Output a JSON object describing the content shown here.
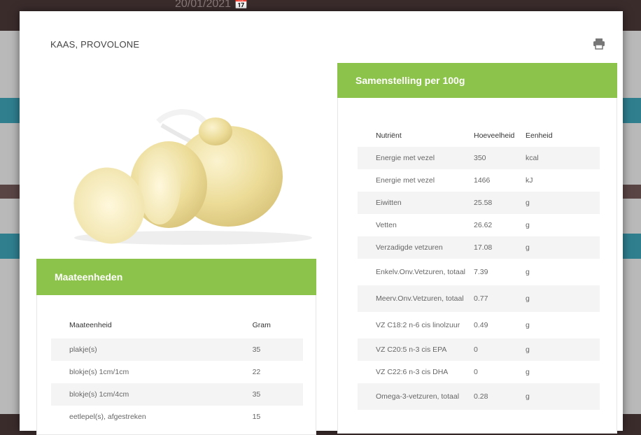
{
  "background": {
    "date_text": "20/01/2021 📅"
  },
  "modal": {
    "title": "KAAS, PROVOLONE",
    "print_icon": "printer-icon"
  },
  "units": {
    "header": "Maateenheden",
    "columns": [
      "Maateenheid",
      "Gram"
    ],
    "rows": [
      {
        "unit": "plakje(s)",
        "gram": "35"
      },
      {
        "unit": "blokje(s) 1cm/1cm",
        "gram": "22"
      },
      {
        "unit": "blokje(s) 1cm/4cm",
        "gram": "35"
      },
      {
        "unit": "eetlepel(s), afgestreken",
        "gram": "15"
      }
    ]
  },
  "composition": {
    "header": "Samenstelling per 100g",
    "columns": [
      "Nutriënt",
      "Hoeveelheid",
      "Eenheid"
    ],
    "rows": [
      {
        "name": "Energie met vezel",
        "amount": "350",
        "unit": "kcal"
      },
      {
        "name": "Energie met vezel",
        "amount": "1466",
        "unit": "kJ"
      },
      {
        "name": "Eiwitten",
        "amount": "25.58",
        "unit": "g"
      },
      {
        "name": "Vetten",
        "amount": "26.62",
        "unit": "g"
      },
      {
        "name": "Verzadigde vetzuren",
        "amount": "17.08",
        "unit": "g"
      },
      {
        "name": "Enkelv.Onv.Vetzuren, totaal",
        "amount": "7.39",
        "unit": "g"
      },
      {
        "name": "Meerv.Onv.Vetzuren, totaal",
        "amount": "0.77",
        "unit": "g"
      },
      {
        "name": "VZ C18:2 n-6 cis linolzuur",
        "amount": "0.49",
        "unit": "g"
      },
      {
        "name": "VZ C20:5 n-3 cis EPA",
        "amount": "0",
        "unit": "g"
      },
      {
        "name": "VZ C22:6 n-3 cis DHA",
        "amount": "0",
        "unit": "g"
      },
      {
        "name": "Omega-3-vetzuren, totaal",
        "amount": "0.28",
        "unit": "g"
      }
    ]
  }
}
